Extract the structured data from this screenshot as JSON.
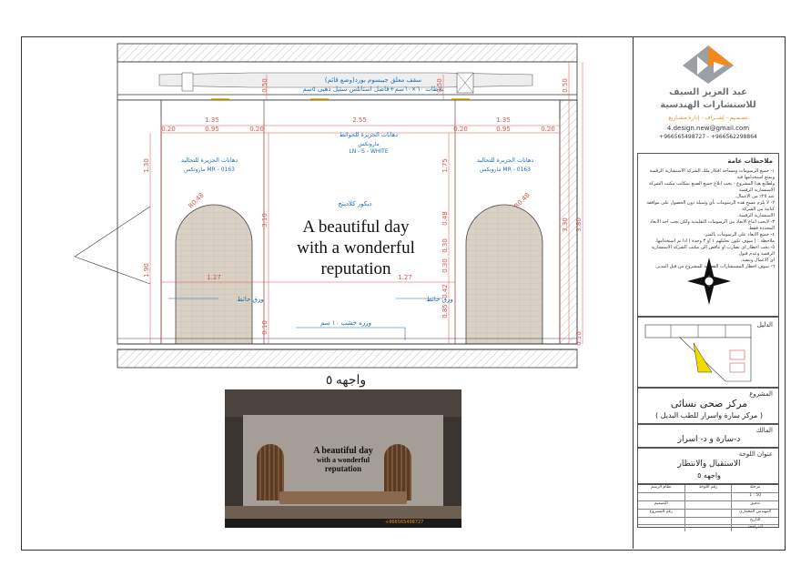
{
  "drawing": {
    "ceiling_label_1": "سقف معلق جيبسوم بورد(وضع قائم)",
    "ceiling_label_2": "بلاطات ٦٠×٦٠سم+فاصل استانلس ستيل ذهبى ٥سم",
    "paint_label_1": "دهانات الجزيرة للتجاليد",
    "paint_code_1": "مارونكس MR - 0163",
    "paint_label_2": "دهانات الجزيرة للحوائط",
    "paint_code_2": "مارونكس",
    "paint_code_2b": "LN - S - WHITE",
    "paint_label_3": "دهانات الجزيرة للتجاليد",
    "paint_code_3": "مارونكس MR - 0163",
    "decor_label": "ديكور كلادينج",
    "wallpaper_left": "ورق حائط",
    "wallpaper_right": "ورق حائط",
    "skirting_label": "وزره خشب ١٠ سم",
    "wall_text_line1": "A beautiful day",
    "wall_text_line2": "with a wonderful",
    "wall_text_line3": "reputation",
    "dims": {
      "d135a": "1.35",
      "d255": "2.55",
      "d135b": "1.35",
      "d020a": "0.20",
      "d095a": "0.95",
      "d020b": "0.20",
      "d020c": "0.20",
      "d095b": "0.95",
      "d020d": "0.20",
      "d130": "1.30",
      "d190": "1.90",
      "d310": "3.10",
      "d010": "0.10",
      "d175": "1.75",
      "d048": "0.48",
      "d030a": "0.30",
      "d030b": "0.30",
      "d042": "0.42",
      "d085": "0.85",
      "d127a": "1.27",
      "d127b": "1.27",
      "d050a": "0.50",
      "d050b": "0.50",
      "d050c": "0.50",
      "d380": "3.80",
      "d330": "3.30",
      "d010b": "0.10",
      "r048a": "R0.48",
      "r048b": "R0.48"
    },
    "caption": "واجهه ٥"
  },
  "photo": {
    "line1": "A beautiful day",
    "line2": "with a wonderful",
    "line3": "reputation",
    "phone": "+966565498727"
  },
  "title_block": {
    "company_line1": "عبد العزيز السيف",
    "company_line2": "للاستشارات الهندسية",
    "company_tagline": "تصـمـيم - إشــراف - إدارة مشـاريع",
    "email": "4.design.new@gmail.com",
    "phones": "+966565498727 - +966562298864",
    "notes_title": "ملاحظات عامة",
    "notes": [
      "١- جميع الرسومات ومساحة افكار ملك الشركة الاستشارية الرقمية ويمنع استخدامها فيه",
      "ولطابع هذا المشروع - يجب ابلاغ جميع الصنع بمكاتب مكتب الشركة الاستشارية الرقمية",
      "عند ٢٥٪ من الاعمال.",
      "٢- لا يلزم مسح هذه الرسومات بأي وسيلة دون الحصول على موافقة كتابية من الشركة",
      "الاستشارية الرقمية.",
      "٣- لايجب اتباع الابعاد من الرسومات التقليدية ولكن يجب اخذ الابعاد المحددة فقط.",
      "٤- جميع الابعاد على الرسومات بالمتر.",
      "ملاحظة : ( سوف تكون تحليلهم ١ او ٣ وحدة ) اذا تم استخدامها.",
      "٥- يجب اخطار اى تضارب او تناقض الى مكتب الشركة الاستشارية الرقمية وعدم قبول",
      "اى الاعمال وتنفيذ.",
      "٦- سوف اخطار المستشارات القطعية للمشروع من قبل المدير."
    ],
    "guide_label": "الدليل",
    "project_label": "المشروع",
    "project_name": "مركز صحى نسائى",
    "project_sub": "( مركز سارة واسرار للطب البديل )",
    "owner_label": "المالك",
    "owner_name": "د-سارة و د- اسرار",
    "sheet_title_label": "عنوان اللوحة",
    "sheet_title_1": "الاستقبال والانتظار",
    "sheet_title_2": "واجهه ٥",
    "table_rows": [
      [
        "نظام الرسم",
        "رقم اللوحة",
        "مرحلة"
      ],
      [
        "",
        "",
        "1 : 50"
      ],
      [
        "التصميم",
        "",
        "تدقيق"
      ],
      [
        "رقم المشروع",
        "",
        "المهندس المعماري"
      ],
      [
        "",
        "",
        "التاريخ"
      ],
      [
        "",
        "",
        "المراجعة"
      ]
    ]
  },
  "colors": {
    "dim_red": "#d9534f",
    "label_blue": "#1e6fb5",
    "arch_fill": "#d9d2c4",
    "logo_orange": "#f08a1e",
    "project_highlight": "#f2d900"
  }
}
